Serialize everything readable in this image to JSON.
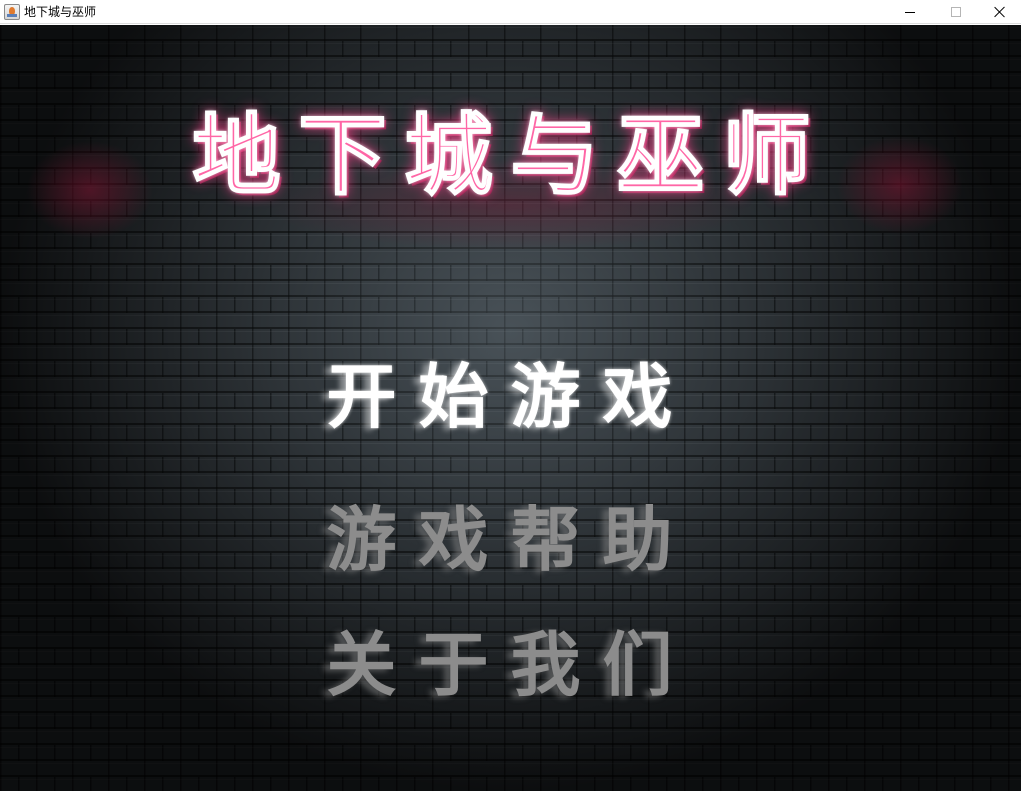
{
  "window": {
    "title": "地下城与巫师",
    "controls": {
      "minimize_icon": "minimize-icon",
      "maximize_icon": "maximize-icon",
      "close_icon": "close-icon"
    }
  },
  "game": {
    "title": "地下城与巫师",
    "title_color": "#ff66a6",
    "menu": [
      {
        "label": "开始游戏",
        "color": "#ffffff",
        "state": "highlighted"
      },
      {
        "label": "游戏帮助",
        "color": "#8c8c8c",
        "state": "normal"
      },
      {
        "label": "关于我们",
        "color": "#8c8c8c",
        "state": "normal"
      }
    ]
  }
}
